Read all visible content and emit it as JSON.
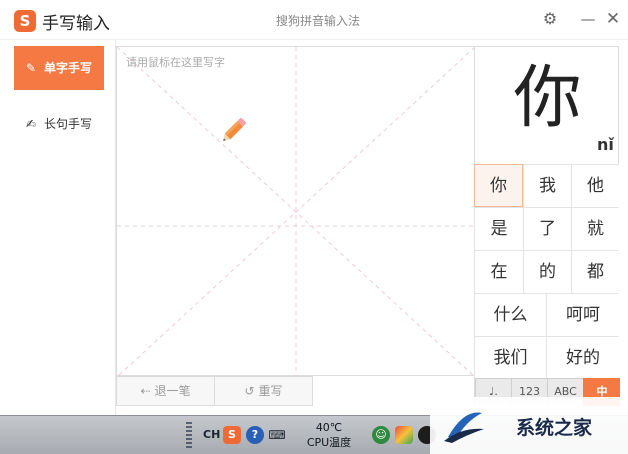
{
  "window": {
    "app_title": "手写输入",
    "title": "搜狗拼音输入法",
    "logo_glyph": "S",
    "settings_icon": "gear-icon",
    "minimize_icon": "minimize-icon",
    "close_icon": "close-icon"
  },
  "nav": {
    "items": [
      {
        "label": "单字手写",
        "icon": "edit-box-icon",
        "active": true
      },
      {
        "label": "长句手写",
        "icon": "pen-lines-icon",
        "active": false
      }
    ]
  },
  "pad": {
    "placeholder": "请用鼠标在这里写字",
    "undo_label": "退一笔",
    "rewrite_label": "重写",
    "cursor_icon": "pencil-icon"
  },
  "candidates": {
    "preview_char": "你",
    "preview_pinyin": "nǐ",
    "rows": [
      [
        "你",
        "我",
        "他"
      ],
      [
        "是",
        "了",
        "就"
      ],
      [
        "在",
        "的",
        "都"
      ],
      [
        "什么",
        "呵呵"
      ],
      [
        "我们",
        "好的"
      ]
    ],
    "selected": "你",
    "modes": [
      {
        "label": "♩.",
        "active": false
      },
      {
        "label": "123",
        "active": false
      },
      {
        "label": "ABC",
        "active": false
      },
      {
        "label": "中",
        "active": true
      }
    ]
  },
  "taskbar": {
    "lang": "CH",
    "temp_value": "40℃",
    "temp_label": "CPU温度",
    "watermark_text": "系统之家"
  },
  "colors": {
    "accent": "#f47943",
    "logo": "#ef6b35"
  }
}
